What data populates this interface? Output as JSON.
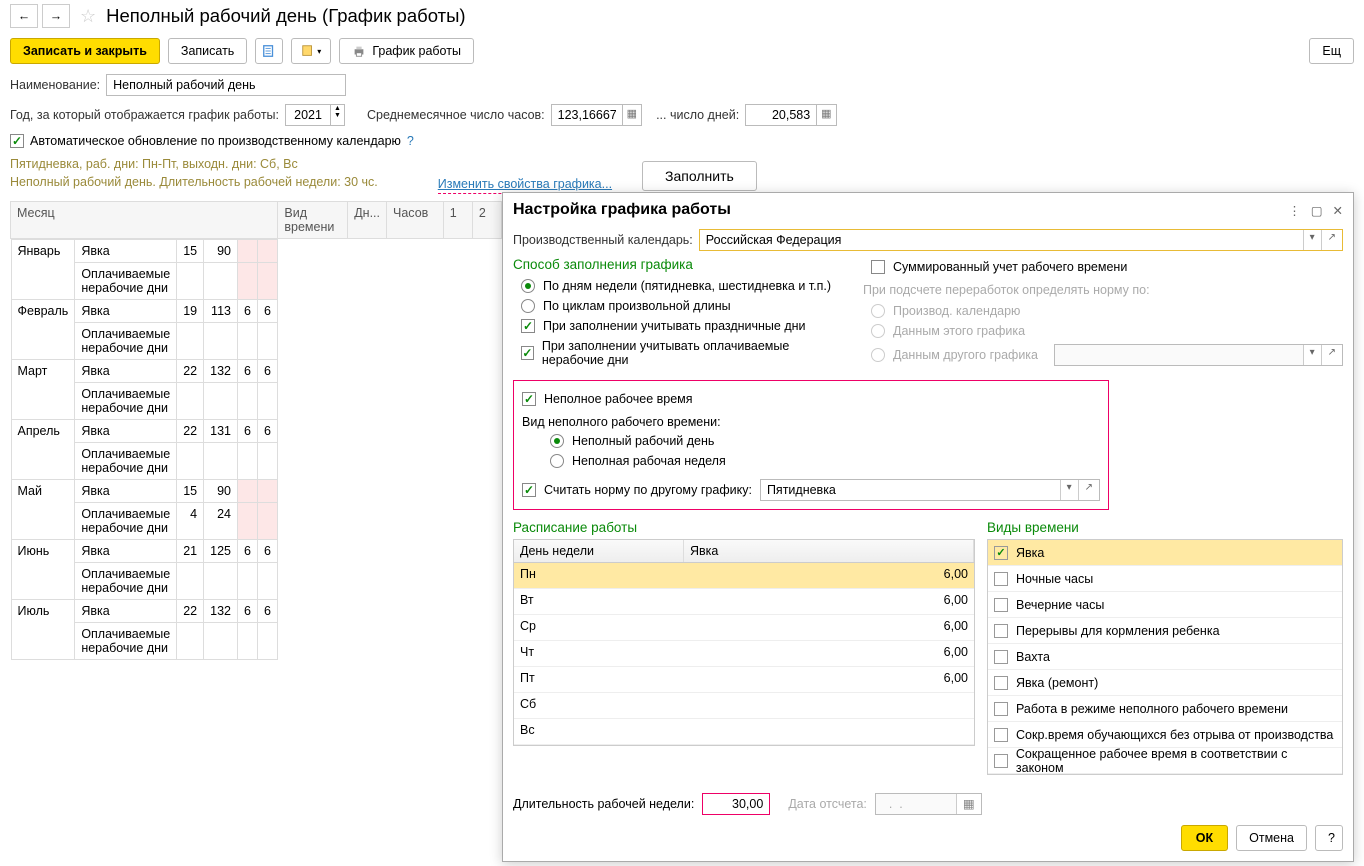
{
  "header": {
    "title": "Неполный рабочий день (График работы)"
  },
  "toolbar": {
    "write_close": "Записать и закрыть",
    "write": "Записать",
    "schedule": "График работы",
    "more": "Ещ"
  },
  "form": {
    "name_label": "Наименование:",
    "name_value": "Неполный рабочий день",
    "year_label": "Год, за который отображается график работы:",
    "year_value": "2021",
    "avg_hours_label": "Среднемесячное число часов:",
    "avg_hours_value": "123,16667",
    "avg_days_label": "... число дней:",
    "avg_days_value": "20,583",
    "auto_update": "Автоматическое обновление по производственному календарю",
    "info_line1": "Пятидневка, раб. дни: Пн-Пт, выходн. дни: Сб, Вс",
    "info_line2": "Неполный рабочий день. Длительность рабочей недели: 30 чс.",
    "change_props": "Изменить свойства графика...",
    "fill": "Заполнить"
  },
  "table_headers": {
    "month": "Месяц",
    "time_type": "Вид времени",
    "days": "Дн...",
    "hours": "Часов",
    "c1": "1",
    "c2": "2"
  },
  "months": [
    {
      "name": "Январь",
      "type1": "Явка",
      "days1": "15",
      "hours1": "90",
      "pink1": true,
      "pink2": true,
      "type2": "Оплачиваемые нерабочие дни"
    },
    {
      "name": "Февраль",
      "type1": "Явка",
      "days1": "19",
      "hours1": "113",
      "c1": "6",
      "c2": "6",
      "type2": "Оплачиваемые нерабочие дни"
    },
    {
      "name": "Март",
      "type1": "Явка",
      "days1": "22",
      "hours1": "132",
      "c1": "6",
      "c2": "6",
      "type2": "Оплачиваемые нерабочие дни"
    },
    {
      "name": "Апрель",
      "type1": "Явка",
      "days1": "22",
      "hours1": "131",
      "c1": "6",
      "c2": "6",
      "type2": "Оплачиваемые нерабочие дни"
    },
    {
      "name": "Май",
      "type1": "Явка",
      "days1": "15",
      "hours1": "90",
      "pink1": true,
      "pink2": true,
      "type2": "Оплачиваемые нерабочие дни",
      "days2": "4",
      "hours2": "24"
    },
    {
      "name": "Июнь",
      "type1": "Явка",
      "days1": "21",
      "hours1": "125",
      "c1": "6",
      "c2": "6",
      "type2": "Оплачиваемые нерабочие дни"
    },
    {
      "name": "Июль",
      "type1": "Явка",
      "days1": "22",
      "hours1": "132",
      "c1": "6",
      "c2": "6",
      "type2": "Оплачиваемые нерабочие дни"
    }
  ],
  "panel": {
    "title": "Настройка графика работы",
    "prod_cal_label": "Производственный календарь:",
    "prod_cal_value": "Российская Федерация",
    "fill_method": "Способ заполнения графика",
    "by_weekdays": "По дням недели (пятидневка, шестидневка и т.п.)",
    "by_cycles": "По циклам произвольной длины",
    "consider_holidays": "При заполнении учитывать праздничные дни",
    "consider_paid_nonwork": "При заполнении учитывать оплачиваемые нерабочие дни",
    "sum_accounting": "Суммированный учет рабочего времени",
    "overtime_label": "При подсчете переработок определять норму по:",
    "opt_prod_cal": "Производ. календарю",
    "opt_this_sched": "Данным этого графика",
    "opt_other_sched": "Данным другого графика",
    "parttime": "Неполное рабочее время",
    "parttime_type_label": "Вид неполного рабочего времени:",
    "parttime_day": "Неполный рабочий день",
    "parttime_week": "Неполная рабочая неделя",
    "calc_by_other": "Считать норму по другому графику:",
    "other_sched_value": "Пятидневка",
    "schedule_title": "Расписание работы",
    "types_title": "Виды времени",
    "sched_col_day": "День недели",
    "sched_col_val": "Явка",
    "schedule_rows": [
      {
        "day": "Пн",
        "val": "6,00",
        "sel": true
      },
      {
        "day": "Вт",
        "val": "6,00"
      },
      {
        "day": "Ср",
        "val": "6,00"
      },
      {
        "day": "Чт",
        "val": "6,00"
      },
      {
        "day": "Пт",
        "val": "6,00"
      },
      {
        "day": "Сб",
        "val": ""
      },
      {
        "day": "Вс",
        "val": ""
      }
    ],
    "time_types": [
      {
        "label": "Явка",
        "checked": true,
        "sel": true
      },
      {
        "label": "Ночные часы"
      },
      {
        "label": "Вечерние часы"
      },
      {
        "label": "Перерывы для кормления ребенка"
      },
      {
        "label": "Вахта"
      },
      {
        "label": "Явка (ремонт)"
      },
      {
        "label": "Работа в режиме неполного рабочего времени"
      },
      {
        "label": "Сокр.время обучающихся без отрыва от производства"
      },
      {
        "label": "Сокращенное рабочее время в соответствии с законом"
      }
    ],
    "week_hours_label": "Длительность рабочей недели:",
    "week_hours_value": "30,00",
    "start_date_label": "Дата отсчета:",
    "start_date_value": "  .  .",
    "ok": "ОК",
    "cancel": "Отмена",
    "help": "?"
  }
}
